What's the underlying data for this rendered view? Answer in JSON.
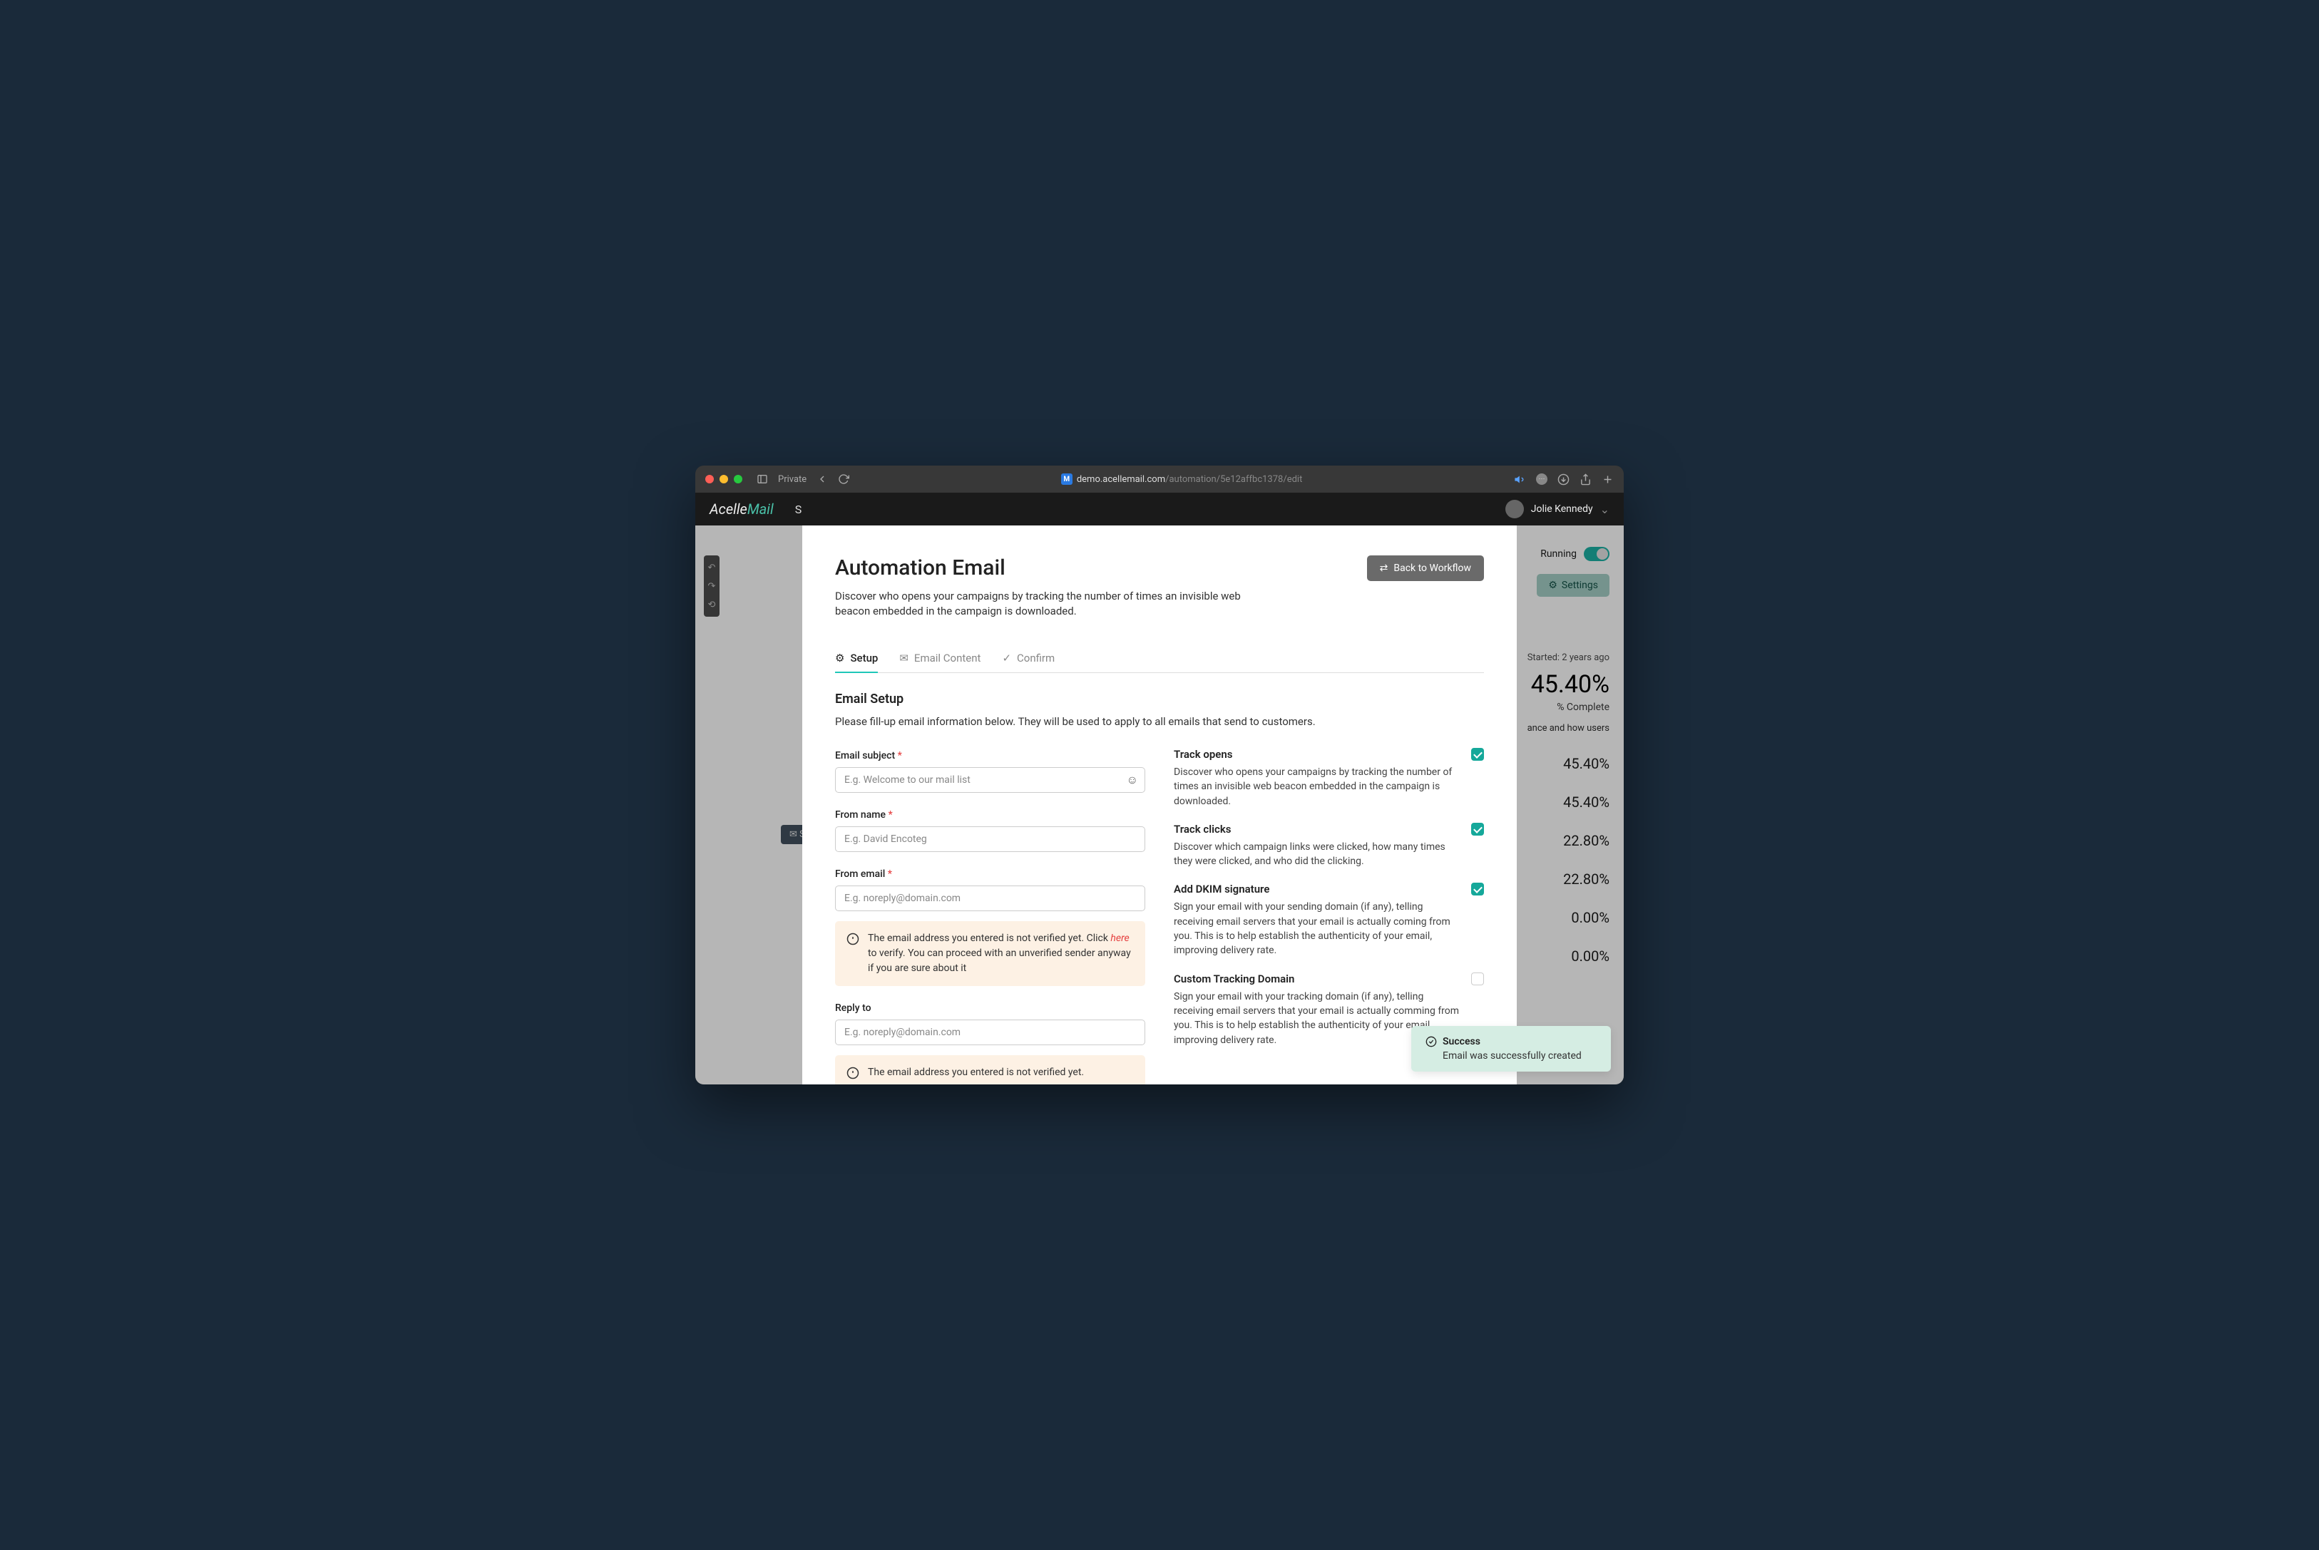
{
  "browser": {
    "private": "Private",
    "url_host": "demo.acellemail.com",
    "url_path": "/automation/5e12affbc1378/edit"
  },
  "header": {
    "logo_a": "Acelle",
    "logo_m": "Mail",
    "user": "Jolie Kennedy"
  },
  "bg": {
    "running": "Running",
    "settings": "Settings",
    "started": "Started: 2 years ago",
    "big_pct": "45.40%",
    "complete": "% Complete",
    "how": "ance and how users",
    "stats": [
      "45.40%",
      "45.40%",
      "22.80%",
      "22.80%",
      "0.00%",
      "0.00%"
    ]
  },
  "modal": {
    "title": "Automation Email",
    "subtitle": "Discover who opens your campaigns by tracking the number of times an invisible web beacon embedded in the campaign is downloaded.",
    "back": "Back to Workflow",
    "tabs": {
      "setup": "Setup",
      "content": "Email Content",
      "confirm": "Confirm"
    },
    "section_title": "Email Setup",
    "section_desc": "Please fill-up email information below. They will be used to apply to all emails that send to customers.",
    "subject_label": "Email subject",
    "subject_ph": "E.g. Welcome to our mail list",
    "from_name_label": "From name",
    "from_name_ph": "E.g. David Encoteg",
    "from_email_label": "From email",
    "from_email_ph": "E.g. noreply@domain.com",
    "alert1_pre": "The email address you entered is not verified yet. Click ",
    "alert1_here": "here",
    "alert1_post": " to verify. You can proceed with an unverified sender anyway if you are sure about it",
    "reply_label": "Reply to",
    "reply_ph": "E.g. noreply@domain.com",
    "alert2": "The email address you entered is not verified yet.",
    "tracks": [
      {
        "title": "Track opens",
        "desc": "Discover who opens your campaigns by tracking the number of times an invisible web beacon embedded in the campaign is downloaded.",
        "checked": true
      },
      {
        "title": "Track clicks",
        "desc": "Discover which campaign links were clicked, how many times they were clicked, and who did the clicking.",
        "checked": true
      },
      {
        "title": "Add DKIM signature",
        "desc": "Sign your email with your sending domain (if any), telling receiving email servers that your email is actually coming from you. This is to help establish the authenticity of your email, improving delivery rate.",
        "checked": true
      },
      {
        "title": "Custom Tracking Domain",
        "desc": "Sign your email with your tracking domain (if any), telling receiving email servers that your email is actually comming from you. This is to help establish the authenticity of your email, improving delivery rate.",
        "checked": false
      }
    ]
  },
  "toast": {
    "title": "Success",
    "msg": "Email was successfully created"
  }
}
